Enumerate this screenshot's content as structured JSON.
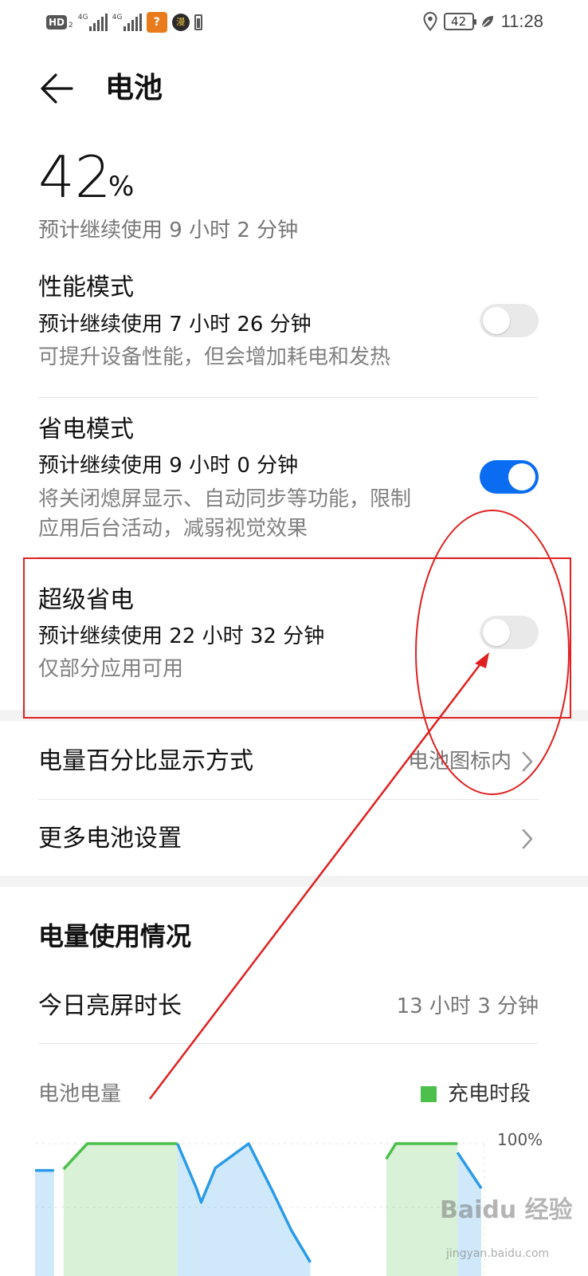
{
  "status_bar": {
    "hd_label": "HD",
    "hd_sub": "2",
    "sig1_tag": "4G",
    "sig2_tag": "4G",
    "app1_glyph": "?",
    "app2_glyph": "漫",
    "battery_level": "42",
    "time": "11:28"
  },
  "header": {
    "title": "电池"
  },
  "battery": {
    "percent": "42",
    "unit": "%",
    "estimate": "预计继续使用 9 小时 2 分钟"
  },
  "modes": [
    {
      "title": "性能模式",
      "estimate": "预计继续使用 7 小时 26 分钟",
      "description": "可提升设备性能，但会增加耗电和发热",
      "enabled": false
    },
    {
      "title": "省电模式",
      "estimate": "预计继续使用 9 小时 0 分钟",
      "description_line1": "将关闭熄屏显示、自动同步等功能，限制",
      "description_line2": "应用后台活动，减弱视觉效果",
      "enabled": true
    },
    {
      "title": "超级省电",
      "estimate": "预计继续使用 22 小时 32 分钟",
      "description": "仅部分应用可用",
      "enabled": false
    }
  ],
  "settings": {
    "percent_display_label": "电量百分比显示方式",
    "percent_display_value": "电池图标内",
    "more_settings_label": "更多电池设置"
  },
  "usage": {
    "section_title": "电量使用情况",
    "screen_time_label": "今日亮屏时长",
    "screen_time_value": "13 小时 3 分钟",
    "battery_level_label": "电池电量",
    "legend_charging": "充电时段",
    "y_max_label": "100%"
  },
  "colors": {
    "accent": "#0a6cf0",
    "charging_green": "#4cc04a",
    "discharge_blue": "#2a9be8",
    "annotation_red": "#e02020"
  },
  "chart_data": {
    "type": "area",
    "title": "",
    "xlabel": "",
    "ylabel": "",
    "ylim": [
      0,
      100
    ],
    "x": [
      0,
      4,
      6,
      11,
      18,
      27,
      30,
      34,
      35,
      38,
      45,
      50,
      54,
      58,
      66,
      70,
      74,
      76,
      84,
      89,
      94
    ],
    "series": [
      {
        "name": "充电时段",
        "values": [
          null,
          null,
          80,
          100,
          100,
          100,
          100,
          null,
          null,
          null,
          null,
          null,
          null,
          null,
          null,
          null,
          88,
          100,
          100,
          100,
          null
        ]
      },
      {
        "values": [
          79,
          79,
          null,
          null,
          null,
          null,
          100,
          65,
          54,
          81,
          100,
          63,
          32,
          7,
          null,
          null,
          null,
          null,
          null,
          93,
          65
        ]
      }
    ]
  },
  "watermark": {
    "text": "Baidu 经验",
    "sub": "jingyan.baidu.com"
  }
}
